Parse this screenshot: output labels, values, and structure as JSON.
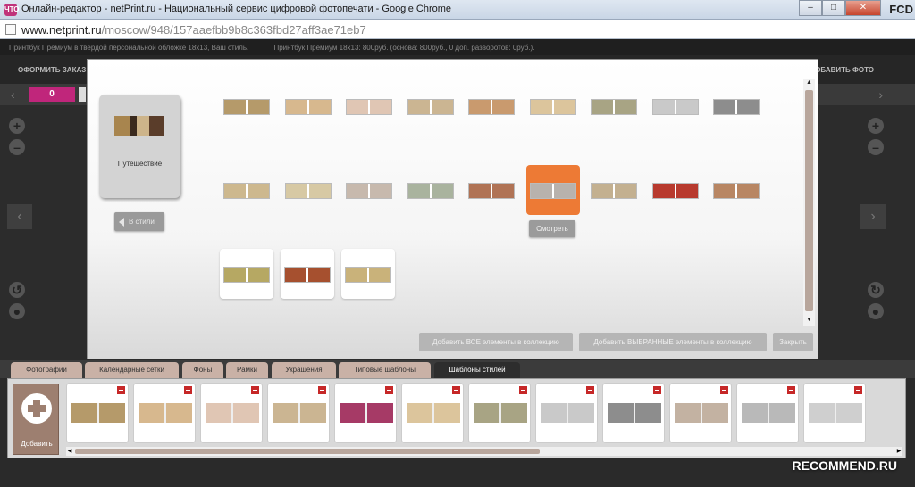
{
  "window": {
    "title": "Онлайн-редактор - netPrint.ru - Национальный сервис цифровой фотопечати - Google Chrome",
    "app_icon_text": "ЧТО",
    "minimize": "–",
    "maximize": "□",
    "close": "✕",
    "badge": "FCD"
  },
  "address": {
    "host": "www.netprint.ru",
    "path": "/moscow/948/157aaefbb9b8c363fbd27aff3ae71eb7"
  },
  "info_bar": {
    "left": "Принтбук Премиум в твердой персональной обложке 18x13, Ваш стиль.",
    "right": "Принтбук Премиум 18x13: 800руб. (основа: 800руб., 0 доп. разворотов: 0руб.)."
  },
  "top_menu": {
    "order": "ОФОРМИТЬ ЗАКАЗ",
    "add_photo": "ДОБАВИТЬ ФОТО"
  },
  "page_bar": {
    "page_number": "0"
  },
  "modal": {
    "style_card_label": "Путешествие",
    "back_button": "В стили",
    "view_button": "Смотреть",
    "add_all_button": "Добавить ВСЕ элементы в коллекцию",
    "add_selected_button": "Добавить ВЫБРАННЫЕ элементы в коллекцию",
    "close_button": "Закрыть",
    "templates_row1": [
      "#b59a6a",
      "#d7b88e",
      "#e0c6b4",
      "#cbb592",
      "#c99a6e",
      "#dcc59c",
      "#a8a484",
      "#c9c9c9",
      "#8d8d8d"
    ],
    "templates_row2": [
      "#cdb88e",
      "#d7c9a4",
      "#c7b9ad",
      "#a9b39e",
      "#b07355",
      "#b8b2ad",
      "#c3b090",
      "#b83a2e",
      "#b88663"
    ],
    "templates_row3": [
      "#b6a863",
      "#a6502f",
      "#c9b27a"
    ]
  },
  "tabs": [
    "Фотографии",
    "Календарные сетки",
    "Фоны",
    "Рамки",
    "Украшения",
    "Типовые шаблоны",
    "Шаблоны стилей"
  ],
  "strip": {
    "add_label": "Добавить",
    "pics": [
      "#b59a6a",
      "#d7b88e",
      "#e0c6b4",
      "#cbb592",
      "#a63a66",
      "#dcc59c",
      "#a8a484",
      "#c9c9c9",
      "#8d8d8d",
      "#c3b2a2",
      "#b9b9b9",
      "#cfcfcf"
    ]
  },
  "watermark": "RECOMMEND.RU"
}
